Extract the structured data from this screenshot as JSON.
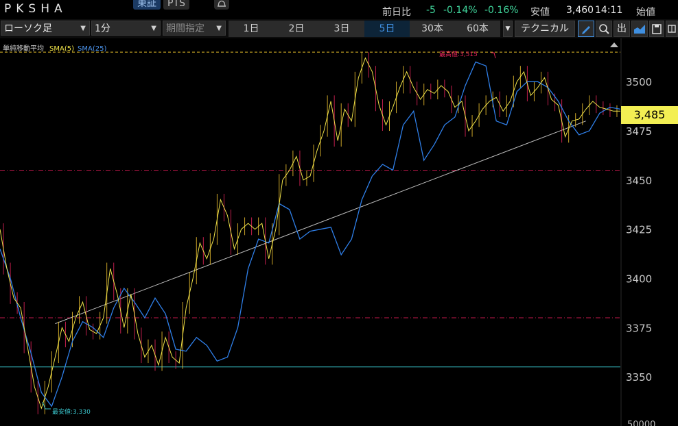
{
  "header": {
    "title": "PKSHA",
    "market_tabs": [
      "東証",
      "PTS"
    ],
    "change_label": "前日比",
    "change_value": "-5",
    "change_pct": "-0.14%",
    "change_pct2": "-0.16%",
    "low_label": "安値",
    "low_value": "3,460",
    "time": "14:11",
    "open_label": "始値"
  },
  "toolbar": {
    "chart_type": "ローソク足",
    "interval": "1分",
    "period_placeholder": "期間指定",
    "ranges": [
      "1日",
      "2日",
      "3日",
      "5日",
      "30本",
      "60本"
    ],
    "active_range": "5日",
    "technical_label": "テクニカル",
    "icons": [
      "pencil-icon",
      "zoom-icon",
      "export-icon",
      "area-chart-icon",
      "save-icon",
      "grid-icon"
    ],
    "out_label": "出"
  },
  "chart": {
    "legend_title": "単純移動平均",
    "sma5_label": "SMA(5)",
    "sma25_label": "SMA(25)",
    "high_annotation": "最高値:3,515",
    "low_annotation": "最安値:3,330",
    "current_price": "3,485",
    "bottom_axis_label": "50000",
    "colors": {
      "background": "#000000",
      "sma5": "#f1e44a",
      "sma25": "#2f7fe8",
      "up": "#f0c330",
      "down": "#e4245a",
      "high_line": "#e6c02a",
      "dash_line": "#c2184b",
      "support_line": "#39c2c9",
      "trend_line": "#bdbdbd",
      "price_box": "#f3ef53"
    }
  },
  "chart_data": {
    "type": "line",
    "title": "",
    "xlabel": "",
    "ylabel": "",
    "ylim": [
      3325,
      3522
    ],
    "yticks": [
      3350,
      3375,
      3400,
      3425,
      3450,
      3475,
      3500
    ],
    "reference_lines": [
      {
        "kind": "high",
        "value": 3515
      },
      {
        "kind": "dash",
        "value": 3455
      },
      {
        "kind": "dash",
        "value": 3380
      },
      {
        "kind": "support",
        "value": 3355
      }
    ],
    "trendline": {
      "from": {
        "x": 16,
        "y": 3377
      },
      "to": {
        "x": 170,
        "y": 3480
      }
    },
    "series": [
      {
        "name": "SMA(25)",
        "x": [
          0,
          3,
          6,
          9,
          12,
          15,
          18,
          21,
          24,
          27,
          30,
          33,
          36,
          39,
          42,
          45,
          48,
          51,
          54,
          57,
          60,
          63,
          66,
          69,
          72,
          75,
          78,
          81,
          84,
          87,
          90,
          93,
          96,
          99,
          102,
          105,
          108,
          111,
          114,
          117,
          120,
          123,
          126,
          129,
          132,
          135,
          138,
          141,
          144,
          147,
          150,
          153,
          156,
          159,
          162,
          165,
          168,
          171,
          174,
          177,
          180
        ],
        "values": [
          3415,
          3400,
          3380,
          3362,
          3342,
          3335,
          3350,
          3368,
          3378,
          3375,
          3370,
          3385,
          3395,
          3388,
          3380,
          3390,
          3382,
          3364,
          3363,
          3370,
          3366,
          3358,
          3360,
          3375,
          3405,
          3420,
          3418,
          3438,
          3435,
          3420,
          3424,
          3425,
          3426,
          3412,
          3420,
          3440,
          3452,
          3458,
          3455,
          3478,
          3485,
          3460,
          3468,
          3478,
          3482,
          3498,
          3510,
          3508,
          3480,
          3478,
          3495,
          3500,
          3500,
          3497,
          3490,
          3480,
          3473,
          3475,
          3484,
          3487,
          3486
        ]
      },
      {
        "name": "SMA(5)",
        "x": [
          0,
          2,
          4,
          6,
          8,
          10,
          12,
          14,
          16,
          18,
          20,
          22,
          24,
          26,
          28,
          30,
          32,
          34,
          36,
          38,
          40,
          42,
          44,
          46,
          48,
          50,
          52,
          54,
          56,
          58,
          60,
          62,
          64,
          66,
          68,
          70,
          72,
          74,
          76,
          78,
          80,
          82,
          84,
          86,
          88,
          90,
          92,
          94,
          96,
          98,
          100,
          102,
          104,
          106,
          108,
          110,
          112,
          114,
          116,
          118,
          120,
          122,
          124,
          126,
          128,
          130,
          132,
          134,
          136,
          138,
          140,
          142,
          144,
          146,
          148,
          150,
          152,
          154,
          156,
          158,
          160,
          162,
          164,
          166,
          168,
          170,
          172,
          174,
          176,
          178,
          180
        ],
        "values": [
          3425,
          3405,
          3390,
          3385,
          3365,
          3345,
          3334,
          3345,
          3360,
          3375,
          3368,
          3380,
          3388,
          3374,
          3372,
          3380,
          3405,
          3392,
          3375,
          3392,
          3372,
          3360,
          3366,
          3356,
          3370,
          3360,
          3357,
          3385,
          3400,
          3418,
          3410,
          3420,
          3440,
          3432,
          3415,
          3425,
          3428,
          3425,
          3428,
          3410,
          3425,
          3450,
          3455,
          3462,
          3450,
          3452,
          3465,
          3475,
          3490,
          3470,
          3486,
          3480,
          3502,
          3512,
          3505,
          3488,
          3478,
          3487,
          3497,
          3505,
          3497,
          3491,
          3496,
          3494,
          3498,
          3495,
          3487,
          3490,
          3475,
          3480,
          3486,
          3490,
          3492,
          3485,
          3490,
          3500,
          3505,
          3493,
          3497,
          3502,
          3491,
          3488,
          3472,
          3480,
          3481,
          3486,
          3490,
          3487,
          3486,
          3485,
          3485
        ]
      }
    ]
  }
}
